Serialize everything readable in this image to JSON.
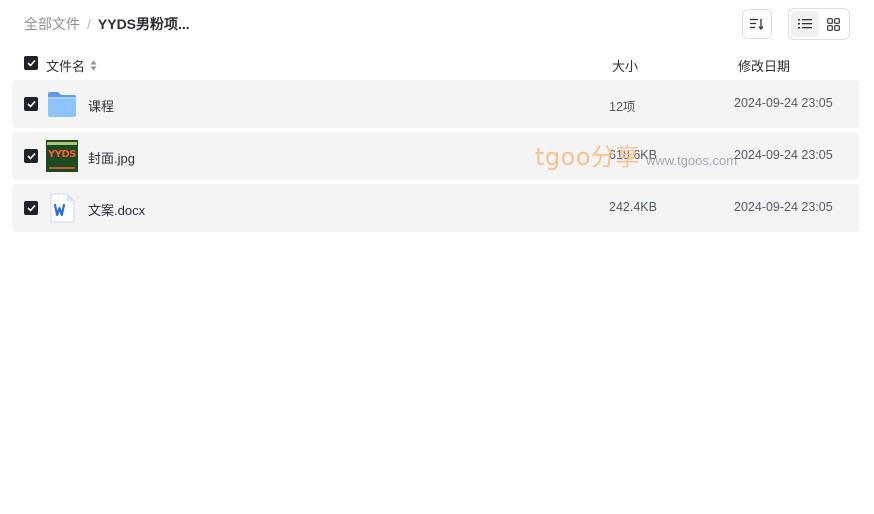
{
  "breadcrumb": {
    "root": "全部文件",
    "separator": "/",
    "current": "YYDS男粉项..."
  },
  "toolbar": {
    "sort_icon": "sort-lines-icon",
    "view_list_icon": "list-view-icon",
    "view_grid_icon": "grid-view-icon",
    "active_view": "list"
  },
  "table": {
    "headers": {
      "name": "文件名",
      "size": "大小",
      "date": "修改日期"
    },
    "rows": [
      {
        "name": "课程",
        "size": "12项",
        "date": "2024-09-24 23:05",
        "icon": "folder-icon",
        "checked": true
      },
      {
        "name": "封面.jpg",
        "size": "618.6KB",
        "date": "2024-09-24 23:05",
        "icon": "image-thumbnail",
        "checked": true
      },
      {
        "name": "文案.docx",
        "size": "242.4KB",
        "date": "2024-09-24 23:05",
        "icon": "word-doc-icon",
        "checked": true
      }
    ]
  },
  "thumbnail": {
    "text": "YYDS"
  },
  "watermark": {
    "brand": "tgoo分享",
    "url": "www.tgoos.com"
  },
  "colors": {
    "row_bg": "#f4f4f5",
    "checkbox": "#1f2329",
    "folder": "#6aaaf0",
    "word_blue": "#2b6fd6",
    "watermark": "#f3c48f"
  }
}
